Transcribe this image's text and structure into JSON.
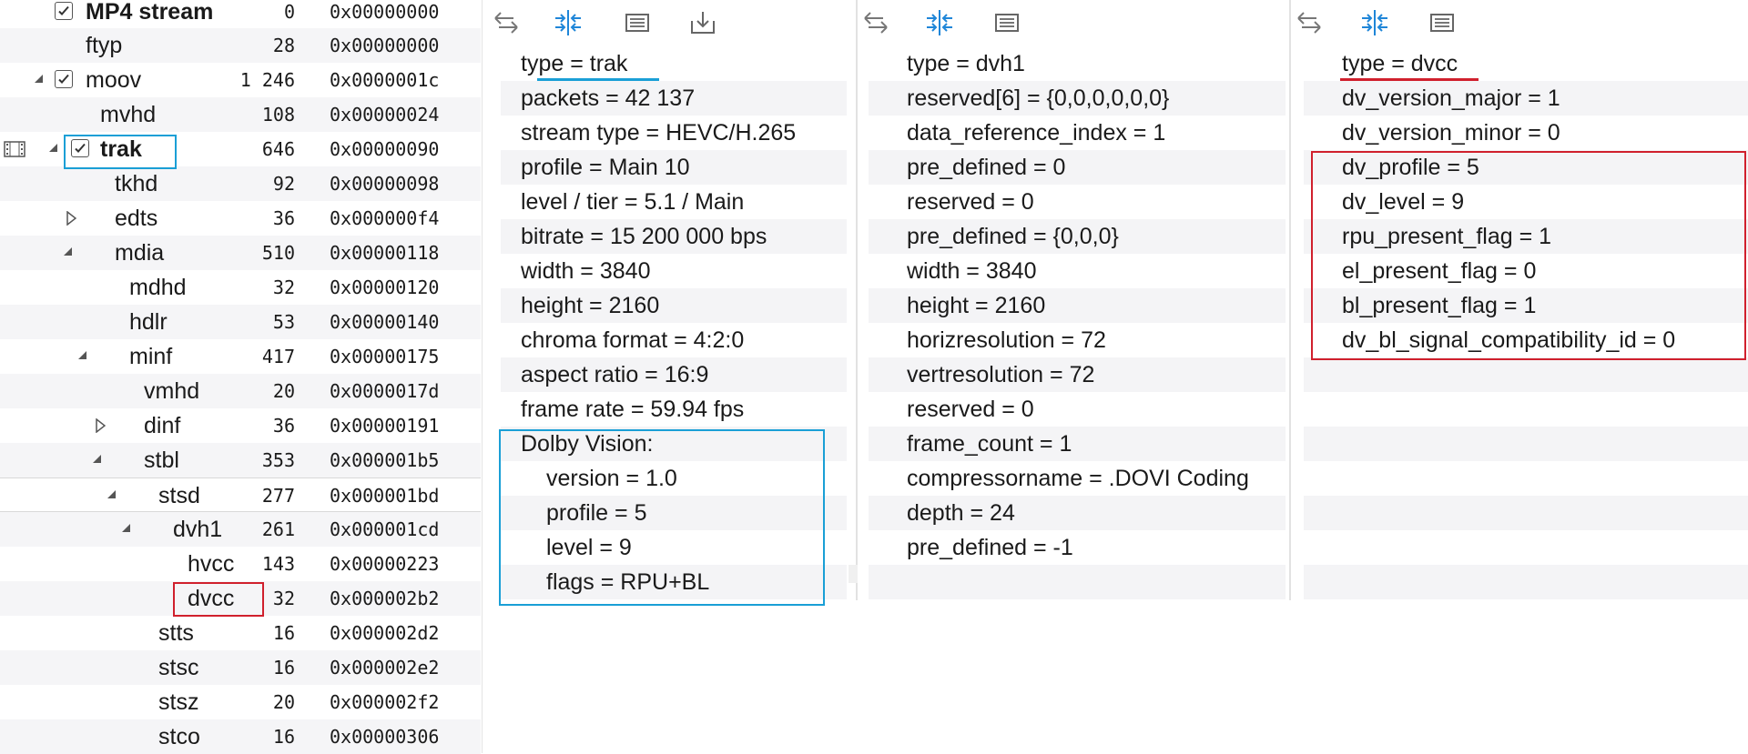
{
  "tree": {
    "rows": [
      {
        "name": "MP4 stream",
        "size": "0",
        "offset": "0x00000000"
      },
      {
        "name": "ftyp",
        "size": "28",
        "offset": "0x00000000"
      },
      {
        "name": "moov",
        "size": "1 246",
        "offset": "0x0000001c"
      },
      {
        "name": "mvhd",
        "size": "108",
        "offset": "0x00000024"
      },
      {
        "name": "trak",
        "size": "646",
        "offset": "0x00000090"
      },
      {
        "name": "tkhd",
        "size": "92",
        "offset": "0x00000098"
      },
      {
        "name": "edts",
        "size": "36",
        "offset": "0x000000f4"
      },
      {
        "name": "mdia",
        "size": "510",
        "offset": "0x00000118"
      },
      {
        "name": "mdhd",
        "size": "32",
        "offset": "0x00000120"
      },
      {
        "name": "hdlr",
        "size": "53",
        "offset": "0x00000140"
      },
      {
        "name": "minf",
        "size": "417",
        "offset": "0x00000175"
      },
      {
        "name": "vmhd",
        "size": "20",
        "offset": "0x0000017d"
      },
      {
        "name": "dinf",
        "size": "36",
        "offset": "0x00000191"
      },
      {
        "name": "stbl",
        "size": "353",
        "offset": "0x000001b5"
      },
      {
        "name": "stsd",
        "size": "277",
        "offset": "0x000001bd"
      },
      {
        "name": "dvh1",
        "size": "261",
        "offset": "0x000001cd"
      },
      {
        "name": "hvcc",
        "size": "143",
        "offset": "0x00000223"
      },
      {
        "name": "dvcc",
        "size": "32",
        "offset": "0x000002b2"
      },
      {
        "name": "stts",
        "size": "16",
        "offset": "0x000002d2"
      },
      {
        "name": "stsc",
        "size": "16",
        "offset": "0x000002e2"
      },
      {
        "name": "stsz",
        "size": "20",
        "offset": "0x000002f2"
      },
      {
        "name": "stco",
        "size": "16",
        "offset": "0x00000306"
      }
    ]
  },
  "panels": {
    "trak": {
      "lines": [
        "type = trak",
        "packets = 42 137",
        "stream type = HEVC/H.265",
        "profile = Main 10",
        "level / tier = 5.1 / Main",
        "bitrate = 15 200 000 bps",
        "width = 3840",
        "height = 2160",
        "chroma format = 4:2:0",
        "aspect ratio = 16:9",
        "frame rate = 59.94 fps",
        "Dolby Vision:",
        "version = 1.0",
        "profile = 5",
        "level = 9",
        "flags = RPU+BL"
      ]
    },
    "dvh1": {
      "lines": [
        "type = dvh1",
        "reserved[6]  =  {0,0,0,0,0,0}",
        "data_reference_index  =  1",
        "pre_defined  =  0",
        "reserved  =  0",
        "pre_defined  =  {0,0,0}",
        "width  =  3840",
        "height  =  2160",
        "horizresolution  =  72",
        "vertresolution  =  72",
        "reserved  =  0",
        "frame_count  =  1",
        "compressorname  =  .DOVI Coding",
        "depth  =  24",
        "pre_defined  =  -1"
      ]
    },
    "dvcc": {
      "lines": [
        "type = dvcc",
        "dv_version_major  =  1",
        "dv_version_minor  =  0",
        "dv_profile  =  5",
        "dv_level  =  9",
        "rpu_present_flag  =  1",
        "el_present_flag  =  0",
        "bl_present_flag  =  1",
        "dv_bl_signal_compatibility_id  =  0"
      ]
    }
  },
  "toolbar": {
    "icons": [
      "swap-arrows-icon",
      "split-merge-icon",
      "list-view-icon",
      "download-icon"
    ]
  },
  "colors": {
    "highlight_blue": "#1a9fd6",
    "highlight_red": "#d0202d",
    "toolbar_blue": "#1f86d8"
  }
}
